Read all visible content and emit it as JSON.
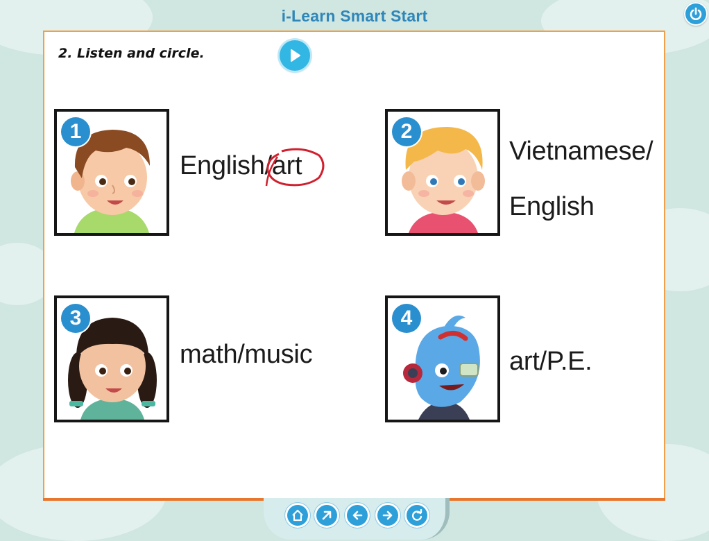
{
  "app": {
    "title": "i-Learn Smart Start"
  },
  "exercise": {
    "instruction": "2. Listen and circle.",
    "items": [
      {
        "number": "1",
        "line1_a": "English/",
        "line1_b": "art",
        "circled": "art"
      },
      {
        "number": "2",
        "line1": "Vietnamese/",
        "line2": "English"
      },
      {
        "number": "3",
        "line1": "math/music"
      },
      {
        "number": "4",
        "line1": "art/P.E."
      }
    ]
  },
  "icons": {
    "power": "power-icon",
    "play": "play-icon",
    "nav": [
      "home-icon",
      "expand-icon",
      "arrow-left-icon",
      "arrow-right-icon",
      "refresh-icon"
    ]
  },
  "colors": {
    "accent": "#2d9fd9",
    "page_border": "#f0a04b",
    "answer_circle": "#d0202e"
  }
}
